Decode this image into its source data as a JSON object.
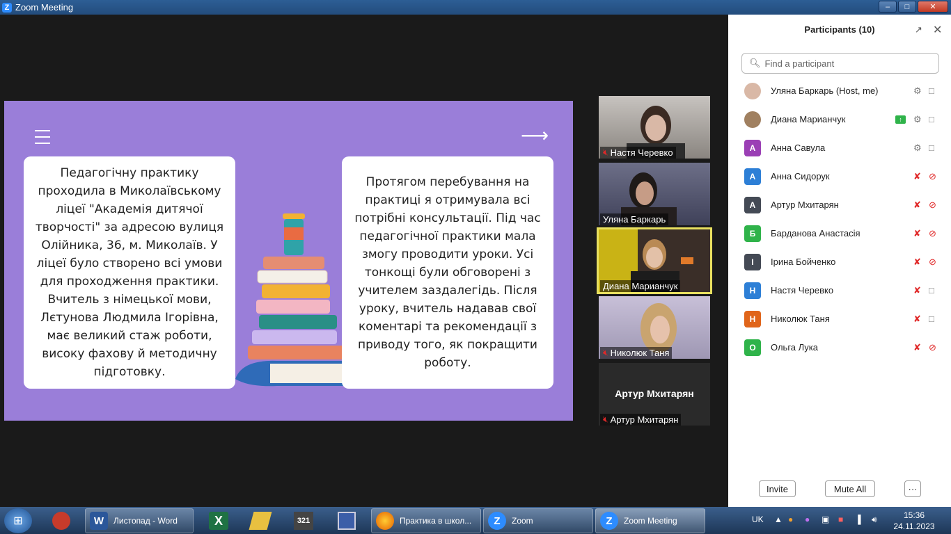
{
  "window": {
    "title": "Zoom Meeting"
  },
  "slide": {
    "left_text": "Педагогічну практику проходила в Миколаївському ліцеї \"Академія дитячої творчості\" за адресою вулиця Олійника, 36, м. Миколаїв. У ліцеї було створено всі умови для проходження практики. Вчитель з німецької мови, Лєтунова Людмила Ігорівна, має великий стаж роботи, високу фахову й методичну підготовку.",
    "right_text": "Протягом перебування на практиці я отримувала всі потрібні консультації. Під час педагогічної практики мала змогу проводити уроки. Усі тонкощі були обговорені з учителем заздалегідь. Після уроку, вчитель надавав свої коментарі та рекомендації з приводу того, як покращити роботу.",
    "colors": {
      "background": "#9a7ed9",
      "card": "#ffffff"
    }
  },
  "video_tiles": [
    {
      "name": "Настя Черевко",
      "muted": true
    },
    {
      "name": "Уляна Баркарь",
      "muted": false
    },
    {
      "name": "Диана Марианчук",
      "muted": false,
      "active_speaker": true
    },
    {
      "name": "Николюк Таня",
      "muted": true
    },
    {
      "name": "Артур Мхитарян",
      "muted": true,
      "big_name": "Артур Мхитарян"
    }
  ],
  "participants_panel": {
    "title": "Participants (10)",
    "search_placeholder": "Find a participant",
    "participants": [
      {
        "initial": "",
        "name": "Уляна Баркарь (Host, me)",
        "avatar_color": "#d9b8a6",
        "mic": "on",
        "cam": "on"
      },
      {
        "initial": "",
        "name": "Диана Марианчук",
        "avatar_color": "#a08060",
        "mic": "on",
        "cam": "on",
        "sharing": true
      },
      {
        "initial": "A",
        "name": "Анна Савула",
        "avatar_color": "#9b3fb5",
        "mic": "on",
        "cam": "on"
      },
      {
        "initial": "A",
        "name": "Анна Сидорук",
        "avatar_color": "#2d7fd6",
        "mic": "off",
        "cam": "off"
      },
      {
        "initial": "A",
        "name": "Артур Мхитарян",
        "avatar_color": "#444a55",
        "mic": "off",
        "cam": "off"
      },
      {
        "initial": "Б",
        "name": "Барданова Анастасія",
        "avatar_color": "#2fb34a",
        "mic": "off",
        "cam": "off"
      },
      {
        "initial": "І",
        "name": "Ірина Бойченко",
        "avatar_color": "#444a55",
        "mic": "off",
        "cam": "off"
      },
      {
        "initial": "Н",
        "name": "Настя Черевко",
        "avatar_color": "#2d7fd6",
        "mic": "off",
        "cam": "on"
      },
      {
        "initial": "Н",
        "name": "Николюк Таня",
        "avatar_color": "#e0651a",
        "mic": "off",
        "cam": "on"
      },
      {
        "initial": "О",
        "name": "Ольга Лука",
        "avatar_color": "#2fb34a",
        "mic": "off",
        "cam": "off"
      }
    ],
    "buttons": {
      "invite": "Invite",
      "mute_all": "Mute All",
      "more": "···"
    }
  },
  "taskbar": {
    "tasks": [
      {
        "label": "Листопад - Word",
        "icon_letter": "W",
        "color": "#2b579a"
      },
      {
        "label": "Практика в школ...",
        "icon_letter": "",
        "color": "#e66000"
      },
      {
        "label": "Zoom",
        "icon_letter": "Z",
        "color": "#2d8cff"
      },
      {
        "label": "Zoom Meeting",
        "icon_letter": "Z",
        "color": "#2d8cff"
      }
    ],
    "language": "UK",
    "time": "15:36",
    "date": "24.11.2023"
  }
}
